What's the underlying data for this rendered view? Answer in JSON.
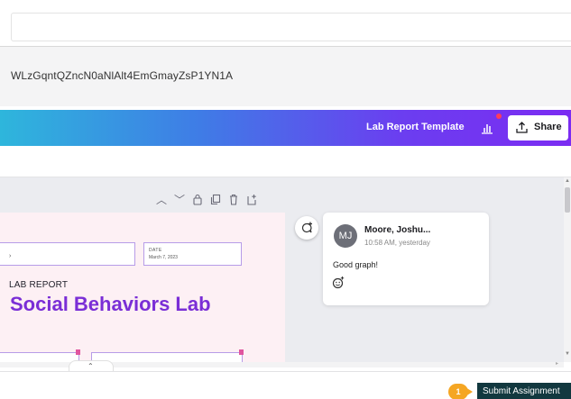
{
  "browser": {
    "url_fragment": "WLzGqntQZncN0aNlAlt4EmGmayZsP1YN1A"
  },
  "editor": {
    "document_title": "Lab Report Template",
    "share_label": "Share",
    "colors": {
      "gradient_start": "#2eb6dc",
      "gradient_end": "#7b2cf2",
      "notification": "#ff3b5c"
    }
  },
  "page": {
    "field_left_text": "›",
    "date_label": "DATE",
    "date_value": "March 7, 2023",
    "section_label": "LAB REPORT",
    "title": "Social Behaviors Lab",
    "title_color": "#7a2ed6"
  },
  "comment": {
    "avatar_initials": "MJ",
    "author": "Moore, Joshu...",
    "time": "10:58 AM, yesterday",
    "text": "Good graph!"
  },
  "footer": {
    "step_badge": "1",
    "submit_label": "Submit Assignment",
    "submit_color": "#12383f"
  }
}
